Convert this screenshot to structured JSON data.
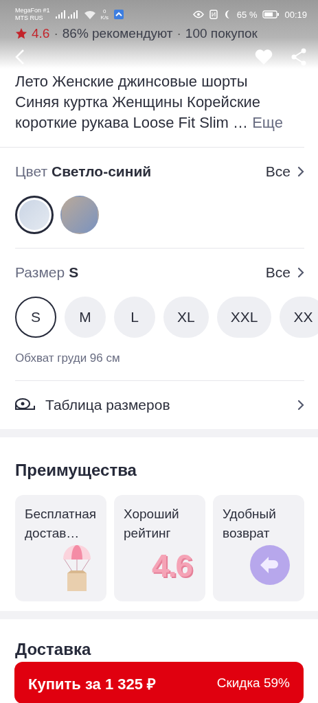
{
  "status_bar": {
    "carrier_1": "MegaFon #1",
    "carrier_2": "MTS RUS",
    "speed_value": "0",
    "speed_unit": "K/s",
    "battery": "65 %",
    "time": "00:19"
  },
  "rating": {
    "score": "4.6",
    "separator": "·",
    "recommend": "86% рекомендуют",
    "purchases": "100 покупок"
  },
  "product": {
    "title": "Лето Женские джинсовые шорты Синяя куртка Женщины Корейские короткие рукава Loose Fit Slim …",
    "more": "Еще"
  },
  "color": {
    "label": "Цвет",
    "value": "Светло-синий",
    "all": "Все",
    "swatches": [
      {
        "selected": true
      },
      {
        "selected": false
      }
    ]
  },
  "size": {
    "label": "Размер",
    "value": "S",
    "all": "Все",
    "options": [
      {
        "label": "S",
        "selected": true
      },
      {
        "label": "M",
        "selected": false
      },
      {
        "label": "L",
        "selected": false
      },
      {
        "label": "XL",
        "selected": false
      },
      {
        "label": "XXL",
        "selected": false
      },
      {
        "label": "XX",
        "selected": false
      }
    ],
    "note": "Обхват груди 96 см"
  },
  "size_table": {
    "label": "Таблица размеров"
  },
  "advantages": {
    "title": "Преимущества",
    "cards": [
      {
        "kind": "parachute",
        "text": "Бесплатная достав…"
      },
      {
        "kind": "rating",
        "text": "Хороший рейтинг",
        "figure": "4.6"
      },
      {
        "kind": "return",
        "text": "Удобный возврат"
      }
    ]
  },
  "delivery": {
    "title": "Доставка"
  },
  "buy_button": {
    "label": "Купить за 1 325 ₽",
    "discount": "Скидка 59%"
  }
}
